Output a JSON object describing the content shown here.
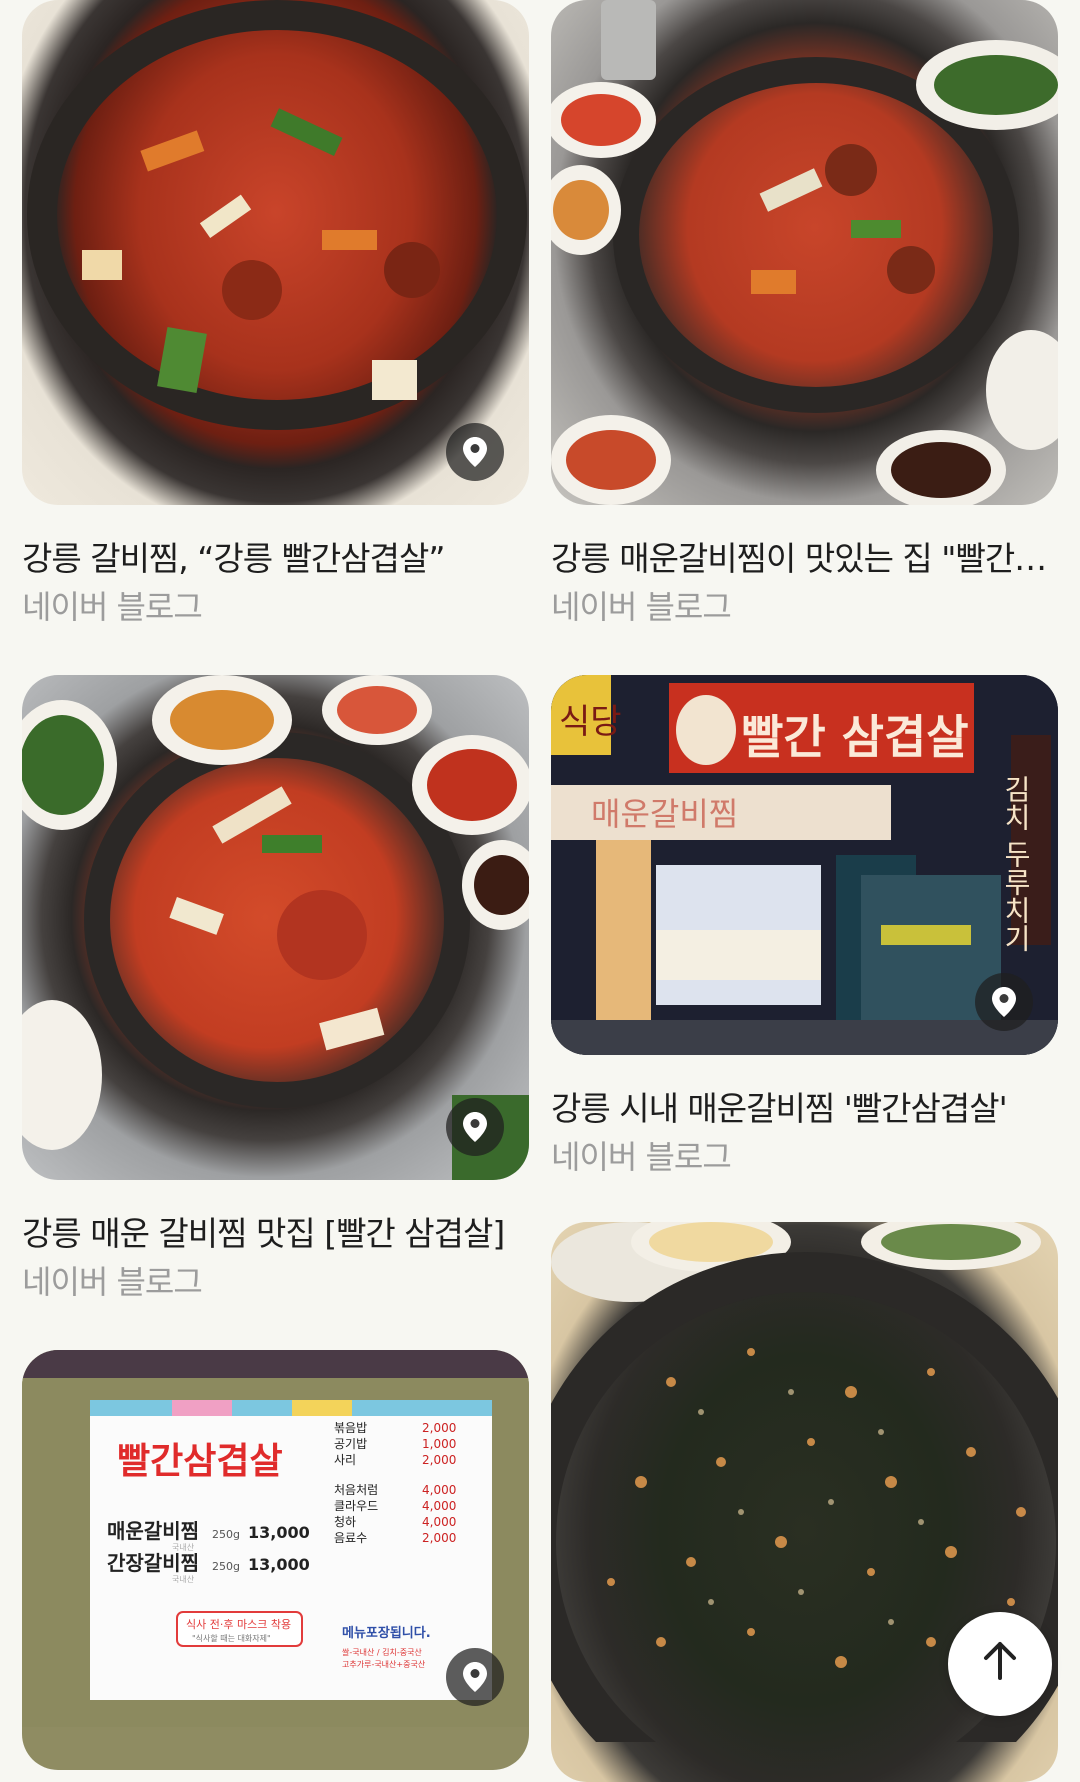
{
  "results": [
    {
      "title": "강릉 갈비찜, “강릉 빨간삼겹살”",
      "source": "네이버 블로그"
    },
    {
      "title": "강릉 매운갈비찜이 맛있는 집 \"빨간…",
      "source": "네이버 블로그"
    },
    {
      "title": "강릉 매운 갈비찜 맛집 [빨간 삼겹살]",
      "source": "네이버 블로그"
    },
    {
      "title": "강릉 시내 매운갈비찜 '빨간삼겹살'",
      "source": "네이버 블로그"
    }
  ],
  "menu_board": {
    "brand": "빨간삼겹살",
    "items_left": [
      {
        "name": "매운갈비찜",
        "weight": "250g",
        "price": "13,000",
        "origin": "국내산"
      },
      {
        "name": "간장갈비찜",
        "weight": "250g",
        "price": "13,000",
        "origin": "국내산"
      }
    ],
    "items_right": [
      {
        "name": "볶음밥",
        "price": "2,000"
      },
      {
        "name": "공기밥",
        "price": "1,000"
      },
      {
        "name": "사리",
        "price": "2,000"
      },
      {
        "name": "처음처럼",
        "price": "4,000"
      },
      {
        "name": "클라우드",
        "price": "4,000"
      },
      {
        "name": "청하",
        "price": "4,000"
      },
      {
        "name": "음료수",
        "price": "2,000"
      }
    ],
    "mask_notice": "식사 전·후 마스크 착용",
    "mask_sub": "\"식사할 때는 대화자제\"",
    "takeout": "메뉴포장됩니다.",
    "origin_note_1": "쌀-국내산 / 김치-중국산",
    "origin_note_2": "고추가루-국내산+중국산"
  },
  "store_sign": {
    "name": "빨간 삼겹살",
    "awning": "매운갈비찜",
    "side_sign": "김치 두루치기",
    "corner_sign": "식당"
  },
  "icons": {
    "pin": "location-pin-icon",
    "top": "arrow-up-icon"
  },
  "colors": {
    "background": "#f7f7f2",
    "title": "#1e1e1e",
    "source": "#9c9c9c"
  }
}
